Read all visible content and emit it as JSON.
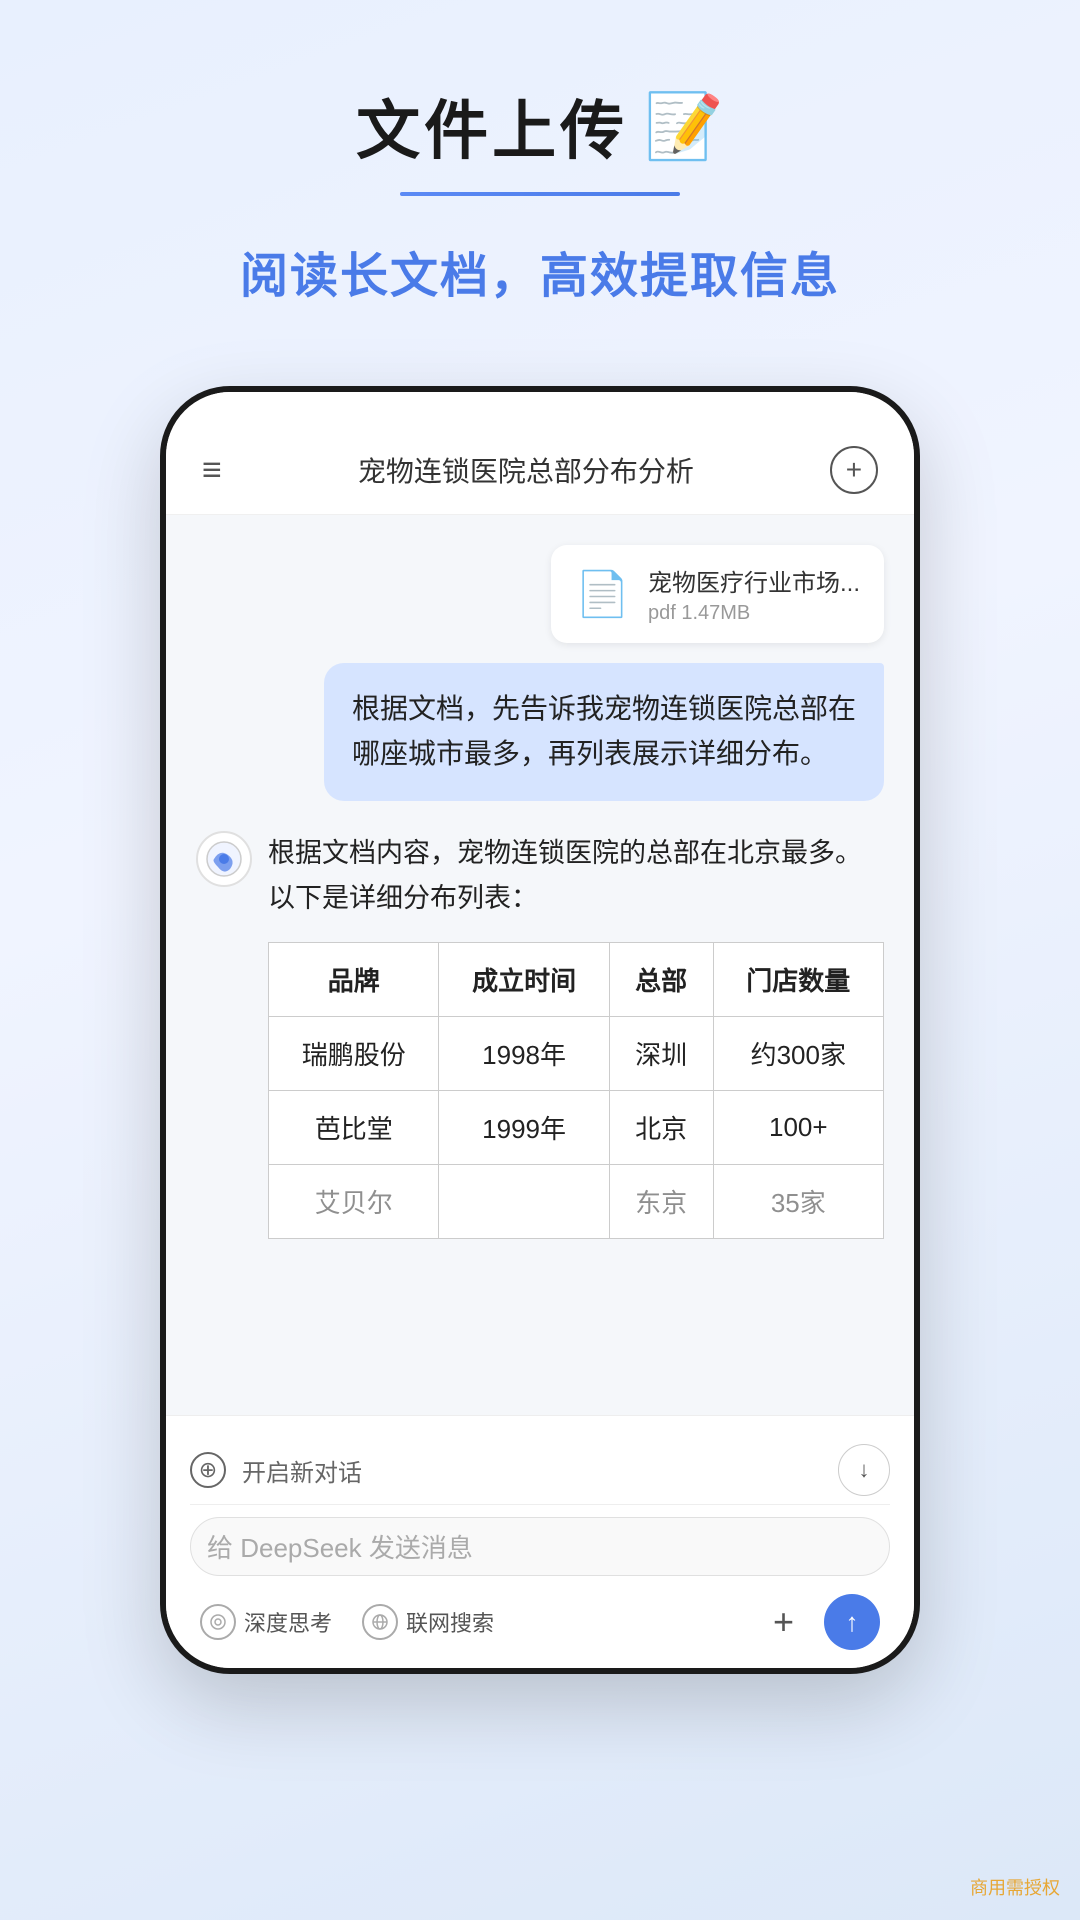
{
  "header": {
    "title": "文件上传",
    "title_emoji": "📝",
    "subtitle": "阅读长文档，高效提取信息"
  },
  "phone": {
    "header": {
      "menu_icon": "≡",
      "title": "宠物连锁医院总部分布分析",
      "add_icon": "+"
    },
    "file": {
      "icon": "📄",
      "name": "宠物医疗行业市场...",
      "size": "pdf 1.47MB"
    },
    "user_message": "根据文档，先告诉我宠物连锁医院总部在哪座城市最多，再列表展示详细分布。",
    "ai_avatar": "🌐",
    "ai_text": "根据文档内容，宠物连锁医院的总部在北京最多。以下是详细分布列表：",
    "table": {
      "headers": [
        "品牌",
        "成立时间",
        "总部",
        "门店数量"
      ],
      "rows": [
        [
          "瑞鹏股份",
          "1998年",
          "深圳",
          "约300家"
        ],
        [
          "芭比堂",
          "1999年",
          "北京",
          "100+"
        ],
        [
          "艾贝尔",
          "",
          "东京",
          "35家"
        ]
      ]
    },
    "new_chat_label": "开启新对话",
    "input_placeholder": "给 DeepSeek 发送消息",
    "toolbar": {
      "deep_think": "深度思考",
      "web_search": "联网搜索",
      "plus": "+",
      "send_icon": "↑"
    }
  },
  "watermark": "商用需授权"
}
